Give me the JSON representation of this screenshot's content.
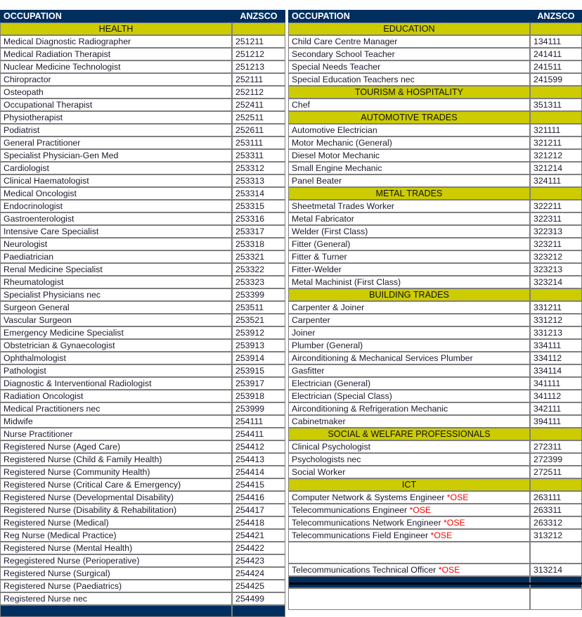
{
  "columns": {
    "occupation": "OCCUPATION",
    "anzsco": "ANZSCO"
  },
  "legend": {
    "ose_marker": "*OSE",
    "ose_color": "#ff0000"
  },
  "colors": {
    "header_navy": "#002f5f",
    "category_yellow": "#cccc00",
    "grid_gray": "#808080",
    "text": "#1a1a2e",
    "ose_red": "#ff0000"
  },
  "left_table": {
    "rows": [
      {
        "kind": "header",
        "occupation": "OCCUPATION",
        "code": "ANZSCO"
      },
      {
        "kind": "category",
        "occupation": "HEALTH",
        "code": ""
      },
      {
        "kind": "data",
        "occupation": "Medical Diagnostic Radiographer",
        "code": "251211"
      },
      {
        "kind": "data",
        "occupation": "Medical Radiation Therapist",
        "code": "251212"
      },
      {
        "kind": "data",
        "occupation": "Nuclear Medicine Technologist",
        "code": "251213"
      },
      {
        "kind": "data",
        "occupation": "Chiropractor",
        "code": "252111"
      },
      {
        "kind": "data",
        "occupation": "Osteopath",
        "code": "252112"
      },
      {
        "kind": "data",
        "occupation": "Occupational Therapist",
        "code": "252411"
      },
      {
        "kind": "data",
        "occupation": "Physiotherapist",
        "code": "252511"
      },
      {
        "kind": "data",
        "occupation": "Podiatrist",
        "code": "252611"
      },
      {
        "kind": "data",
        "occupation": "General Practitioner",
        "code": "253111"
      },
      {
        "kind": "data",
        "occupation": "Specialist Physician-Gen Med",
        "code": "253311"
      },
      {
        "kind": "data",
        "occupation": "Cardiologist",
        "code": "253312"
      },
      {
        "kind": "data",
        "occupation": "Clinical Haematologist",
        "code": "253313"
      },
      {
        "kind": "data",
        "occupation": "Medical Oncologist",
        "code": "253314"
      },
      {
        "kind": "data",
        "occupation": "Endocrinologist",
        "code": "253315"
      },
      {
        "kind": "data",
        "occupation": "Gastroenterologist",
        "code": "253316"
      },
      {
        "kind": "data",
        "occupation": "Intensive Care Specialist",
        "code": "253317"
      },
      {
        "kind": "data",
        "occupation": "Neurologist",
        "code": "253318"
      },
      {
        "kind": "data",
        "occupation": "Paediatrician",
        "code": "253321"
      },
      {
        "kind": "data",
        "occupation": "Renal Medicine Specialist",
        "code": "253322"
      },
      {
        "kind": "data",
        "occupation": "Rheumatologist",
        "code": "253323"
      },
      {
        "kind": "data",
        "occupation": "Specialist Physicians nec",
        "code": "253399"
      },
      {
        "kind": "data",
        "occupation": "Surgeon General",
        "code": "253511"
      },
      {
        "kind": "data",
        "occupation": "Vascular Surgeon",
        "code": "253521"
      },
      {
        "kind": "data",
        "occupation": "Emergency Medicine Specialist",
        "code": "253912"
      },
      {
        "kind": "data",
        "occupation": "Obstetrician & Gynaecologist",
        "code": "253913"
      },
      {
        "kind": "data",
        "occupation": "Ophthalmologist",
        "code": "253914"
      },
      {
        "kind": "data",
        "occupation": "Pathologist",
        "code": "253915"
      },
      {
        "kind": "data",
        "occupation": "Diagnostic & Interventional Radiologist",
        "code": "253917"
      },
      {
        "kind": "data",
        "occupation": "Radiation Oncologist",
        "code": "253918"
      },
      {
        "kind": "data",
        "occupation": "Medical Practitioners nec",
        "code": "253999"
      },
      {
        "kind": "data",
        "occupation": "Midwife",
        "code": "254111"
      },
      {
        "kind": "data",
        "occupation": "Nurse Practitioner",
        "code": "254411"
      },
      {
        "kind": "data",
        "occupation": "Registered Nurse (Aged Care)",
        "code": "254412"
      },
      {
        "kind": "data",
        "occupation": "Registered Nurse (Child & Family Health)",
        "code": "254413"
      },
      {
        "kind": "data",
        "occupation": "Registered Nurse (Community Health)",
        "code": "254414"
      },
      {
        "kind": "data",
        "occupation": "Registered Nurse (Critical Care & Emergency)",
        "code": "254415"
      },
      {
        "kind": "data",
        "occupation": "Registered Nurse (Developmental Disability)",
        "code": "254416"
      },
      {
        "kind": "data",
        "occupation": "Registered Nurse (Disability & Rehabilitation)",
        "code": "254417"
      },
      {
        "kind": "data",
        "occupation": "Registered Nurse (Medical)",
        "code": "254418"
      },
      {
        "kind": "data",
        "occupation": "Reg Nurse (Medical Practice)",
        "code": "254421"
      },
      {
        "kind": "data",
        "occupation": "Registered Nurse (Mental Health)",
        "code": "254422"
      },
      {
        "kind": "data",
        "occupation": "Regegistered Nurse (Perioperative)",
        "code": "254423"
      },
      {
        "kind": "data",
        "occupation": "Registered Nurse (Surgical)",
        "code": "254424"
      },
      {
        "kind": "data",
        "occupation": "Registered Nurse (Paediatrics)",
        "code": "254425"
      },
      {
        "kind": "data",
        "occupation": "Registered Nurse nec",
        "code": "254499"
      },
      {
        "kind": "navy",
        "occupation": "",
        "code": ""
      }
    ]
  },
  "right_table": {
    "rows": [
      {
        "kind": "header",
        "occupation": "OCCUPATION",
        "code": "ANZSCO"
      },
      {
        "kind": "category",
        "occupation": "EDUCATION",
        "code": ""
      },
      {
        "kind": "data",
        "occupation": "Child Care Centre Manager",
        "code": "134111"
      },
      {
        "kind": "data",
        "occupation": "Secondary School Teacher",
        "code": "241411"
      },
      {
        "kind": "data",
        "occupation": "Special Needs Teacher",
        "code": "241511"
      },
      {
        "kind": "data",
        "occupation": "Special Education Teachers nec",
        "code": "241599"
      },
      {
        "kind": "category",
        "occupation": "TOURISM & HOSPITALITY",
        "code": ""
      },
      {
        "kind": "data",
        "occupation": "Chef",
        "code": "351311"
      },
      {
        "kind": "category",
        "occupation": "AUTOMOTIVE TRADES",
        "code": ""
      },
      {
        "kind": "data",
        "occupation": "Automotive Electrician",
        "code": "321111"
      },
      {
        "kind": "data",
        "occupation": "Motor Mechanic (General)",
        "code": "321211"
      },
      {
        "kind": "data",
        "occupation": "Diesel Motor Mechanic",
        "code": "321212"
      },
      {
        "kind": "data",
        "occupation": "Small Engine Mechanic",
        "code": "321214"
      },
      {
        "kind": "data",
        "occupation": "Panel Beater",
        "code": "324111"
      },
      {
        "kind": "category",
        "occupation": "METAL TRADES",
        "code": ""
      },
      {
        "kind": "data",
        "occupation": "Sheetmetal Trades Worker",
        "code": "322211"
      },
      {
        "kind": "data",
        "occupation": "Metal Fabricator",
        "code": "322311"
      },
      {
        "kind": "data",
        "occupation": "Welder (First Class)",
        "code": "322313"
      },
      {
        "kind": "data",
        "occupation": "Fitter (General)",
        "code": "323211"
      },
      {
        "kind": "data",
        "occupation": "Fitter & Turner",
        "code": "323212"
      },
      {
        "kind": "data",
        "occupation": "Fitter-Welder",
        "code": "323213"
      },
      {
        "kind": "data",
        "occupation": "Metal Machinist (First Class)",
        "code": "323214"
      },
      {
        "kind": "category",
        "occupation": "BUILDING TRADES",
        "code": ""
      },
      {
        "kind": "data",
        "occupation": "Carpenter & Joiner",
        "code": "331211"
      },
      {
        "kind": "data",
        "occupation": "Carpenter",
        "code": "331212"
      },
      {
        "kind": "data",
        "occupation": "Joiner",
        "code": "331213"
      },
      {
        "kind": "data",
        "occupation": "Plumber (General)",
        "code": "334111"
      },
      {
        "kind": "data",
        "occupation": "Airconditioning & Mechanical Services Plumber",
        "code": "334112"
      },
      {
        "kind": "data",
        "occupation": "Gasfitter",
        "code": "334114"
      },
      {
        "kind": "data",
        "occupation": "Electrician (General)",
        "code": "341111"
      },
      {
        "kind": "data",
        "occupation": "Electrician (Special Class)",
        "code": "341112"
      },
      {
        "kind": "data",
        "occupation": "Airconditioning & Refrigeration Mechanic",
        "code": "342111"
      },
      {
        "kind": "data",
        "occupation": "Cabinetmaker",
        "code": "394111"
      },
      {
        "kind": "category",
        "occupation": "SOCIAL & WELFARE PROFESSIONALS",
        "code": ""
      },
      {
        "kind": "data",
        "occupation": "Clinical Psychologist",
        "code": "272311"
      },
      {
        "kind": "data",
        "occupation": "Psychologists nec",
        "code": "272399"
      },
      {
        "kind": "data",
        "occupation": "Social Worker",
        "code": "272511"
      },
      {
        "kind": "category",
        "occupation": "ICT",
        "code": ""
      },
      {
        "kind": "data",
        "occupation": "Computer Network & Systems Engineer ",
        "ose": "*OSE",
        "code": "263111"
      },
      {
        "kind": "data",
        "occupation": "Telecommunications Engineer  ",
        "ose": "*OSE",
        "code": "263311"
      },
      {
        "kind": "data",
        "occupation": "Telecommunications Network Engineer  ",
        "ose": "*OSE",
        "code": "263312"
      },
      {
        "kind": "data",
        "occupation": "Telecommunications Field Engineer ",
        "ose": "*OSE",
        "code": "313212"
      },
      {
        "kind": "blank",
        "occupation": "",
        "code": ""
      },
      {
        "kind": "data",
        "occupation": "Telecommunications Technical Officer  ",
        "ose": "*OSE",
        "code": "313214"
      },
      {
        "kind": "navy",
        "occupation": "",
        "code": ""
      },
      {
        "kind": "blank",
        "occupation": "",
        "code": ""
      }
    ]
  }
}
